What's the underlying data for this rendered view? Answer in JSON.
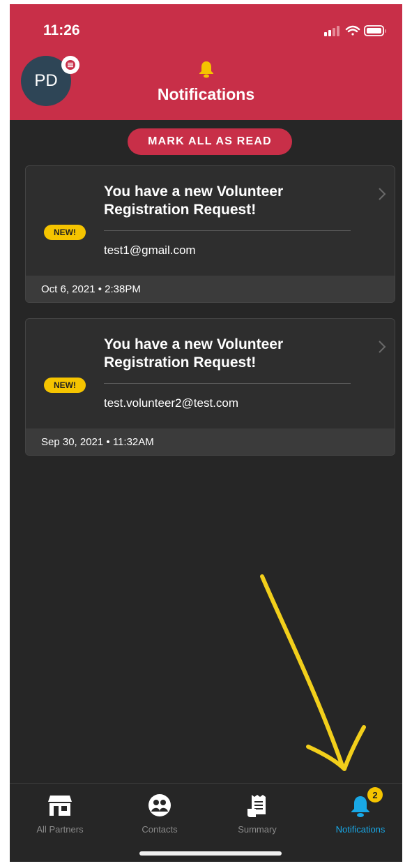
{
  "status_bar": {
    "time": "11:26"
  },
  "header": {
    "avatar_initials": "PD",
    "title": "Notifications"
  },
  "actions": {
    "mark_all_label": "MARK ALL AS READ"
  },
  "notifications": [
    {
      "badge": "NEW!",
      "title": "You have a new Volunteer Registration Request!",
      "email": "test1@gmail.com",
      "timestamp": "Oct 6, 2021 • 2:38PM"
    },
    {
      "badge": "NEW!",
      "title": "You have a new Volunteer Registration Request!",
      "email": "test.volunteer2@test.com",
      "timestamp": "Sep 30, 2021 • 11:32AM"
    }
  ],
  "tabbar": {
    "tabs": [
      {
        "label": "All Partners",
        "icon": "storefront-icon"
      },
      {
        "label": "Contacts",
        "icon": "contacts-icon"
      },
      {
        "label": "Summary",
        "icon": "summary-icon"
      },
      {
        "label": "Notifications",
        "icon": "bell-icon",
        "badge": "2"
      }
    ],
    "active": "Notifications"
  },
  "colors": {
    "brand": "#c82f48",
    "badge": "#f5c400",
    "active_tab": "#19a8e6",
    "background": "#262626"
  }
}
